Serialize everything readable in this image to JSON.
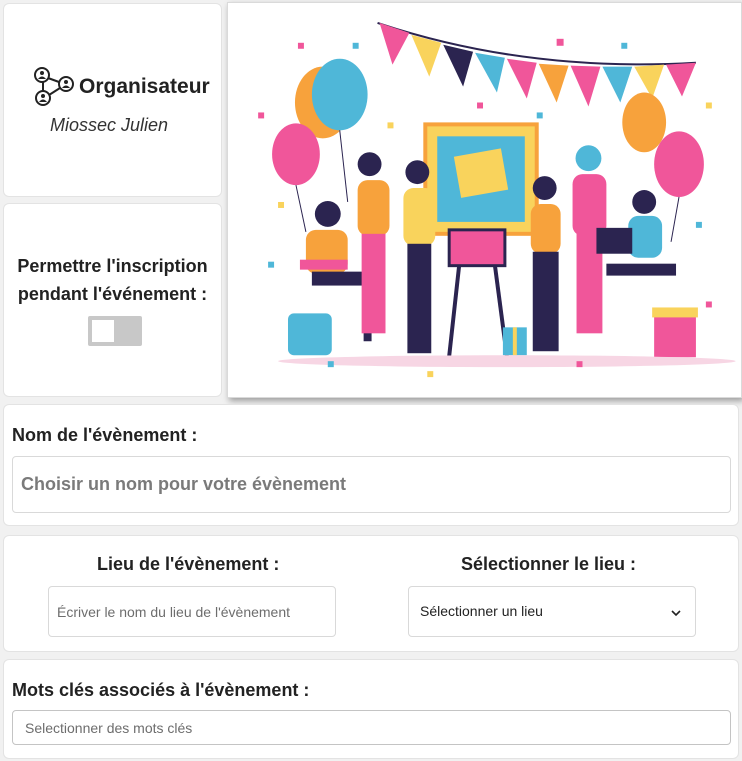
{
  "organizer": {
    "title": "Organisateur",
    "name": "Miossec Julien",
    "icon": "network-people-icon"
  },
  "registration": {
    "label": "Permettre l'inscription pendant l'événement :",
    "toggle_on": false
  },
  "illustration": {
    "icon": "party-illustration",
    "colors": {
      "pink": "#f0569a",
      "blue": "#4fb7d8",
      "orange": "#f7a23c",
      "yellow": "#f9d35c",
      "navy": "#2b2450"
    }
  },
  "event_name": {
    "label": "Nom de l'évènement :",
    "placeholder": "Choisir un nom pour votre évènement",
    "value": ""
  },
  "location": {
    "label_text": "Lieu de l'évènement :",
    "placeholder": "Écriver le nom du lieu de l'évènement",
    "select_label": "Sélectionner le lieu :",
    "select_value": "Sélectionner un lieu",
    "select_icon": "chevron-down-icon"
  },
  "keywords": {
    "label": "Mots clés associés à l'évènement :",
    "placeholder": "Selectionner des mots clés",
    "value": ""
  }
}
